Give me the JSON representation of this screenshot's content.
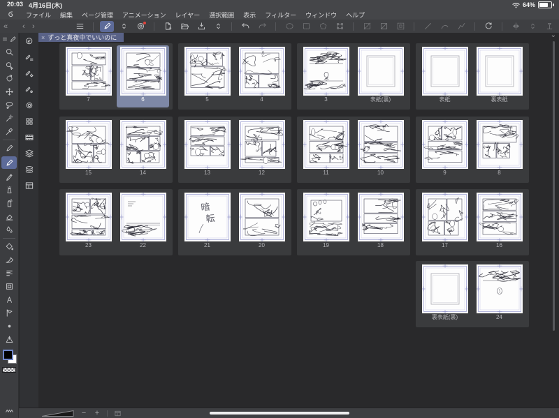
{
  "colors": {
    "chrome": "#454649",
    "toolbarbg": "#3e3f42",
    "canvas": "#29292b",
    "group": "#3a3b3d",
    "colA": "#3c3d40",
    "colB": "#303134",
    "sel": "#7e88a6",
    "accent": "#5d6b99",
    "tab": "#596287",
    "icon": "#c6c7c9",
    "icondim": "#737477",
    "scroll": "#ededee"
  },
  "status_bar": {
    "time": "20:03",
    "date": "4月16日(木)",
    "battery": "64%"
  },
  "menu_bar": {
    "items": [
      {
        "id": "file",
        "label": "ファイル"
      },
      {
        "id": "edit",
        "label": "編集"
      },
      {
        "id": "page-management",
        "label": "ページ管理"
      },
      {
        "id": "animation",
        "label": "アニメーション"
      },
      {
        "id": "layer",
        "label": "レイヤー"
      },
      {
        "id": "selection",
        "label": "選択範囲"
      },
      {
        "id": "view",
        "label": "表示"
      },
      {
        "id": "filter",
        "label": "フィルター"
      },
      {
        "id": "window",
        "label": "ウィンドウ"
      },
      {
        "id": "help",
        "label": "ヘルプ"
      }
    ]
  },
  "toolbar": {
    "nav": [
      {
        "id": "collapse-left",
        "glyph": "«"
      },
      {
        "id": "history-back",
        "glyph": "‹"
      },
      {
        "id": "history-forward",
        "glyph": "›"
      }
    ],
    "groups": [
      {
        "items": [
          {
            "id": "main-menu",
            "icon": "menu"
          }
        ]
      },
      {
        "items": [
          {
            "id": "edit-mode",
            "icon": "marker",
            "active": true
          },
          {
            "id": "tool-switcher",
            "icon": "chevupdown"
          },
          {
            "id": "sync-settings",
            "icon": "register",
            "badge": true
          }
        ]
      },
      {
        "items": [
          {
            "id": "new-canvas",
            "icon": "newpage"
          },
          {
            "id": "open-file",
            "icon": "openfolder"
          },
          {
            "id": "save-export",
            "icon": "importicon"
          },
          {
            "id": "save-options",
            "icon": "chevupdown"
          }
        ]
      },
      {
        "items": [
          {
            "id": "undo",
            "icon": "undo"
          },
          {
            "id": "redo",
            "icon": "redo",
            "disabled": true
          }
        ]
      },
      {
        "items": [
          {
            "id": "select-ellipse",
            "icon": "selellipse",
            "disabled": true
          },
          {
            "id": "select-rect",
            "icon": "selrect",
            "disabled": true
          },
          {
            "id": "select-polygon",
            "icon": "selpoly",
            "disabled": true
          },
          {
            "id": "transform",
            "icon": "transformicon",
            "disabled": true
          }
        ]
      },
      {
        "items": [
          {
            "id": "deselect",
            "icon": "deselect",
            "disabled": true
          },
          {
            "id": "invert-selection",
            "icon": "invertsel",
            "disabled": true
          },
          {
            "id": "expand-selection",
            "icon": "expandsel",
            "disabled": true
          }
        ]
      },
      {
        "items": [
          {
            "id": "line-straight",
            "icon": "linestraight",
            "disabled": true
          },
          {
            "id": "line-curve",
            "icon": "linecurve",
            "disabled": true
          },
          {
            "id": "line-polyline",
            "icon": "linepoly",
            "disabled": true
          }
        ]
      },
      {
        "items": [
          {
            "id": "snap-rotate",
            "icon": "snaprotate"
          }
        ]
      },
      {
        "items": [
          {
            "id": "flip-horizontal",
            "icon": "flipicon",
            "disabled": true
          },
          {
            "id": "flip-options",
            "icon": "chevupdown",
            "disabled": true
          },
          {
            "id": "onion-skin",
            "icon": "onionicon",
            "disabled": true
          }
        ]
      }
    ],
    "collapse_glyph": "⌄"
  },
  "tab": {
    "close": "×",
    "title": "ずっと真夜中でいいのに"
  },
  "sidebar": {
    "tools": [
      {
        "id": "zoom-tool",
        "icon": "zoom"
      },
      {
        "id": "object-select-tool",
        "icon": "zoomsel"
      },
      {
        "id": "rotate-canvas-tool",
        "icon": "rotatecanvas"
      },
      {
        "id": "move-tool",
        "icon": "move"
      },
      {
        "id": "lasso-tool",
        "icon": "lasso"
      },
      {
        "id": "auto-select-tool",
        "icon": "wand"
      },
      {
        "id": "eyedropper-tool",
        "icon": "eyedrop"
      },
      {
        "divider": true
      },
      {
        "id": "pen-tool",
        "icon": "pen"
      },
      {
        "id": "marker-tool",
        "icon": "marker",
        "active": true
      },
      {
        "id": "pencil-tool",
        "icon": "pencil"
      },
      {
        "id": "airbrush-tool",
        "icon": "airbrush"
      },
      {
        "id": "decoration-tool",
        "icon": "decor"
      },
      {
        "id": "eraser-tool",
        "icon": "eraser"
      },
      {
        "id": "blend-tool",
        "icon": "blend"
      },
      {
        "divider": true
      },
      {
        "id": "fill-tool",
        "icon": "fill"
      },
      {
        "id": "gradient-tool",
        "icon": "gradient"
      },
      {
        "id": "hatch-tool",
        "icon": "hatch"
      },
      {
        "id": "frame-border-tool",
        "icon": "framebox"
      },
      {
        "id": "text-tool",
        "icon": "textA"
      },
      {
        "id": "balloon-tool",
        "icon": "balloon"
      },
      {
        "id": "figure-tool",
        "icon": "dot"
      },
      {
        "id": "ruler-tool",
        "icon": "rulericon"
      }
    ],
    "color_swatches": {
      "main": "#000000",
      "sub": "#ffffff"
    },
    "subpanel": [
      {
        "id": "reset-view",
        "icon": "resetview"
      },
      {
        "id": "subtool-draft-pen",
        "icon": "penlines"
      },
      {
        "id": "subtool-pen-settings",
        "icon": "pengear"
      },
      {
        "id": "subtool-pen-opacity",
        "icon": "pentarget"
      },
      {
        "id": "brush-size-palette",
        "icon": "ringicon"
      },
      {
        "id": "material-palette",
        "icon": "gridicon"
      },
      {
        "id": "timeline-palette",
        "icon": "filmicon"
      },
      {
        "id": "layer-palette",
        "icon": "layersicon"
      },
      {
        "id": "layer-property-palette",
        "icon": "layersflat"
      },
      {
        "id": "page-manager-palette",
        "icon": "panelicon"
      }
    ]
  },
  "pages": {
    "blackout_text": "暗転",
    "rows": [
      {
        "groups": [
          {
            "col": 0,
            "pages": [
              {
                "label": "7",
                "variant": "dense"
              },
              {
                "label": "6",
                "variant": "dense",
                "selected": true
              }
            ]
          },
          {
            "col": 1,
            "pages": [
              {
                "label": "5",
                "variant": "dense"
              },
              {
                "label": "4",
                "variant": "dense"
              }
            ]
          },
          {
            "col": 2,
            "pages": [
              {
                "label": "3",
                "variant": "bands"
              },
              {
                "label": "表紙(裏)",
                "variant": "blank"
              }
            ]
          },
          {
            "col": 3,
            "pages": [
              {
                "label": "表紙",
                "variant": "blank"
              },
              {
                "label": "裏表紙",
                "variant": "blank"
              }
            ]
          }
        ]
      },
      {
        "groups": [
          {
            "col": 0,
            "pages": [
              {
                "label": "15",
                "variant": "dense"
              },
              {
                "label": "14",
                "variant": "dense"
              }
            ]
          },
          {
            "col": 1,
            "pages": [
              {
                "label": "13",
                "variant": "dense"
              },
              {
                "label": "12",
                "variant": "dense"
              }
            ]
          },
          {
            "col": 2,
            "pages": [
              {
                "label": "11",
                "variant": "dense"
              },
              {
                "label": "10",
                "variant": "dense"
              }
            ]
          },
          {
            "col": 3,
            "pages": [
              {
                "label": "9",
                "variant": "dense"
              },
              {
                "label": "8",
                "variant": "dense"
              }
            ]
          }
        ]
      },
      {
        "groups": [
          {
            "col": 0,
            "pages": [
              {
                "label": "23",
                "variant": "dense"
              },
              {
                "label": "22",
                "variant": "bottomband"
              }
            ]
          },
          {
            "col": 1,
            "pages": [
              {
                "label": "21",
                "variant": "blackout"
              },
              {
                "label": "20",
                "variant": "dense"
              }
            ]
          },
          {
            "col": 2,
            "pages": [
              {
                "label": "19",
                "variant": "sparse"
              },
              {
                "label": "18",
                "variant": "dense"
              }
            ]
          },
          {
            "col": 3,
            "pages": [
              {
                "label": "17",
                "variant": "dense"
              },
              {
                "label": "16",
                "variant": "dense"
              }
            ]
          }
        ]
      },
      {
        "groups": [
          {
            "col": 3,
            "pages": [
              {
                "label": "裏表紙(裏)",
                "variant": "blank"
              },
              {
                "label": "24",
                "variant": "topband"
              }
            ]
          }
        ]
      }
    ]
  },
  "bottom_bar": {
    "zoom_out": "−",
    "zoom_in": "+"
  }
}
